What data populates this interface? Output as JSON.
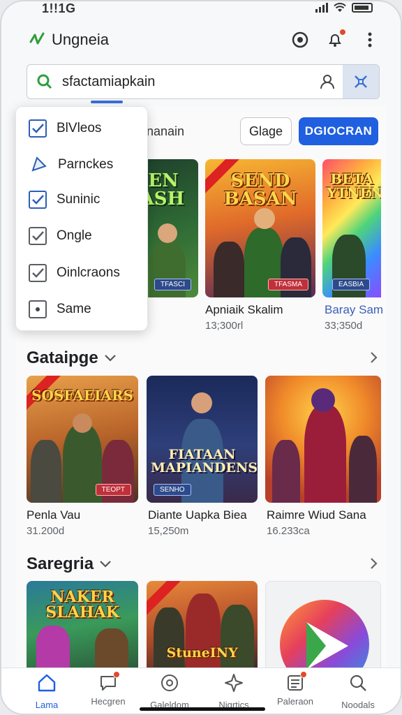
{
  "status": {
    "time": "1!!1G"
  },
  "appbar": {
    "title": "Ungneia"
  },
  "search": {
    "value": "sfactamiapkain"
  },
  "filters": {
    "partial_label": "nanain",
    "outline_button": "Glage",
    "primary_button": "DGIOCRAN"
  },
  "dropdown": {
    "items": [
      {
        "label": "BlVleos",
        "icon": "checkbox-checked-icon"
      },
      {
        "label": "Parnckes",
        "icon": "diamond-icon"
      },
      {
        "label": "Suninic",
        "icon": "checkbox-checked-icon"
      },
      {
        "label": "Ongle",
        "icon": "checkbox-checked-icon"
      },
      {
        "label": "Oinlcraons",
        "icon": "checkbox-checked-icon"
      },
      {
        "label": "Same",
        "icon": "radio-dot-icon"
      }
    ]
  },
  "top_row": [
    {
      "art_title": "EIEN\nMASH",
      "badge": "TFASCI",
      "name": "",
      "sub": ""
    },
    {
      "art_title": "SEND\nBASAN",
      "badge": "TFASMA",
      "name": "Apniaik Skalim",
      "sub": "13;300rl"
    },
    {
      "art_title": "BETA\nYTNEN",
      "badge": "EASBIA",
      "name": "Baray Sam",
      "sub": "33;350d"
    }
  ],
  "section1": {
    "title": "Gataipge",
    "games": [
      {
        "art_title": "SOSFAEIARS",
        "badge": "TEOPT",
        "name": "Penla Vau",
        "sub": "31.200d"
      },
      {
        "art_title": "FIATAAN\nMAPIANDENSM",
        "badge": "SENHO",
        "name": "Diante Uapka Biea",
        "sub": "15,250m"
      },
      {
        "art_title": "",
        "badge": "",
        "name": "Raimre Wiud Sana",
        "sub": "16.233ca"
      }
    ]
  },
  "section2": {
    "title": "Saregria",
    "games": [
      {
        "art_title": "NAKER\nSLAHAK"
      },
      {
        "art_title": "StuneINY"
      },
      {
        "art_title": ""
      }
    ]
  },
  "nav": [
    {
      "label": "Lama",
      "icon": "home-icon",
      "active": true
    },
    {
      "label": "Hecgren",
      "icon": "chat-icon",
      "active": false
    },
    {
      "label": "Galeldom",
      "icon": "search-circle-icon",
      "active": false
    },
    {
      "label": "Nigrtics",
      "icon": "spark-icon",
      "active": false
    },
    {
      "label": "Paleraon",
      "icon": "list-icon",
      "active": false
    },
    {
      "label": "Noodals",
      "icon": "search-icon",
      "active": false
    }
  ],
  "colors": {
    "accent": "#1f5fe0",
    "notify": "#e04a2a",
    "logo": "#2e9d3c"
  }
}
